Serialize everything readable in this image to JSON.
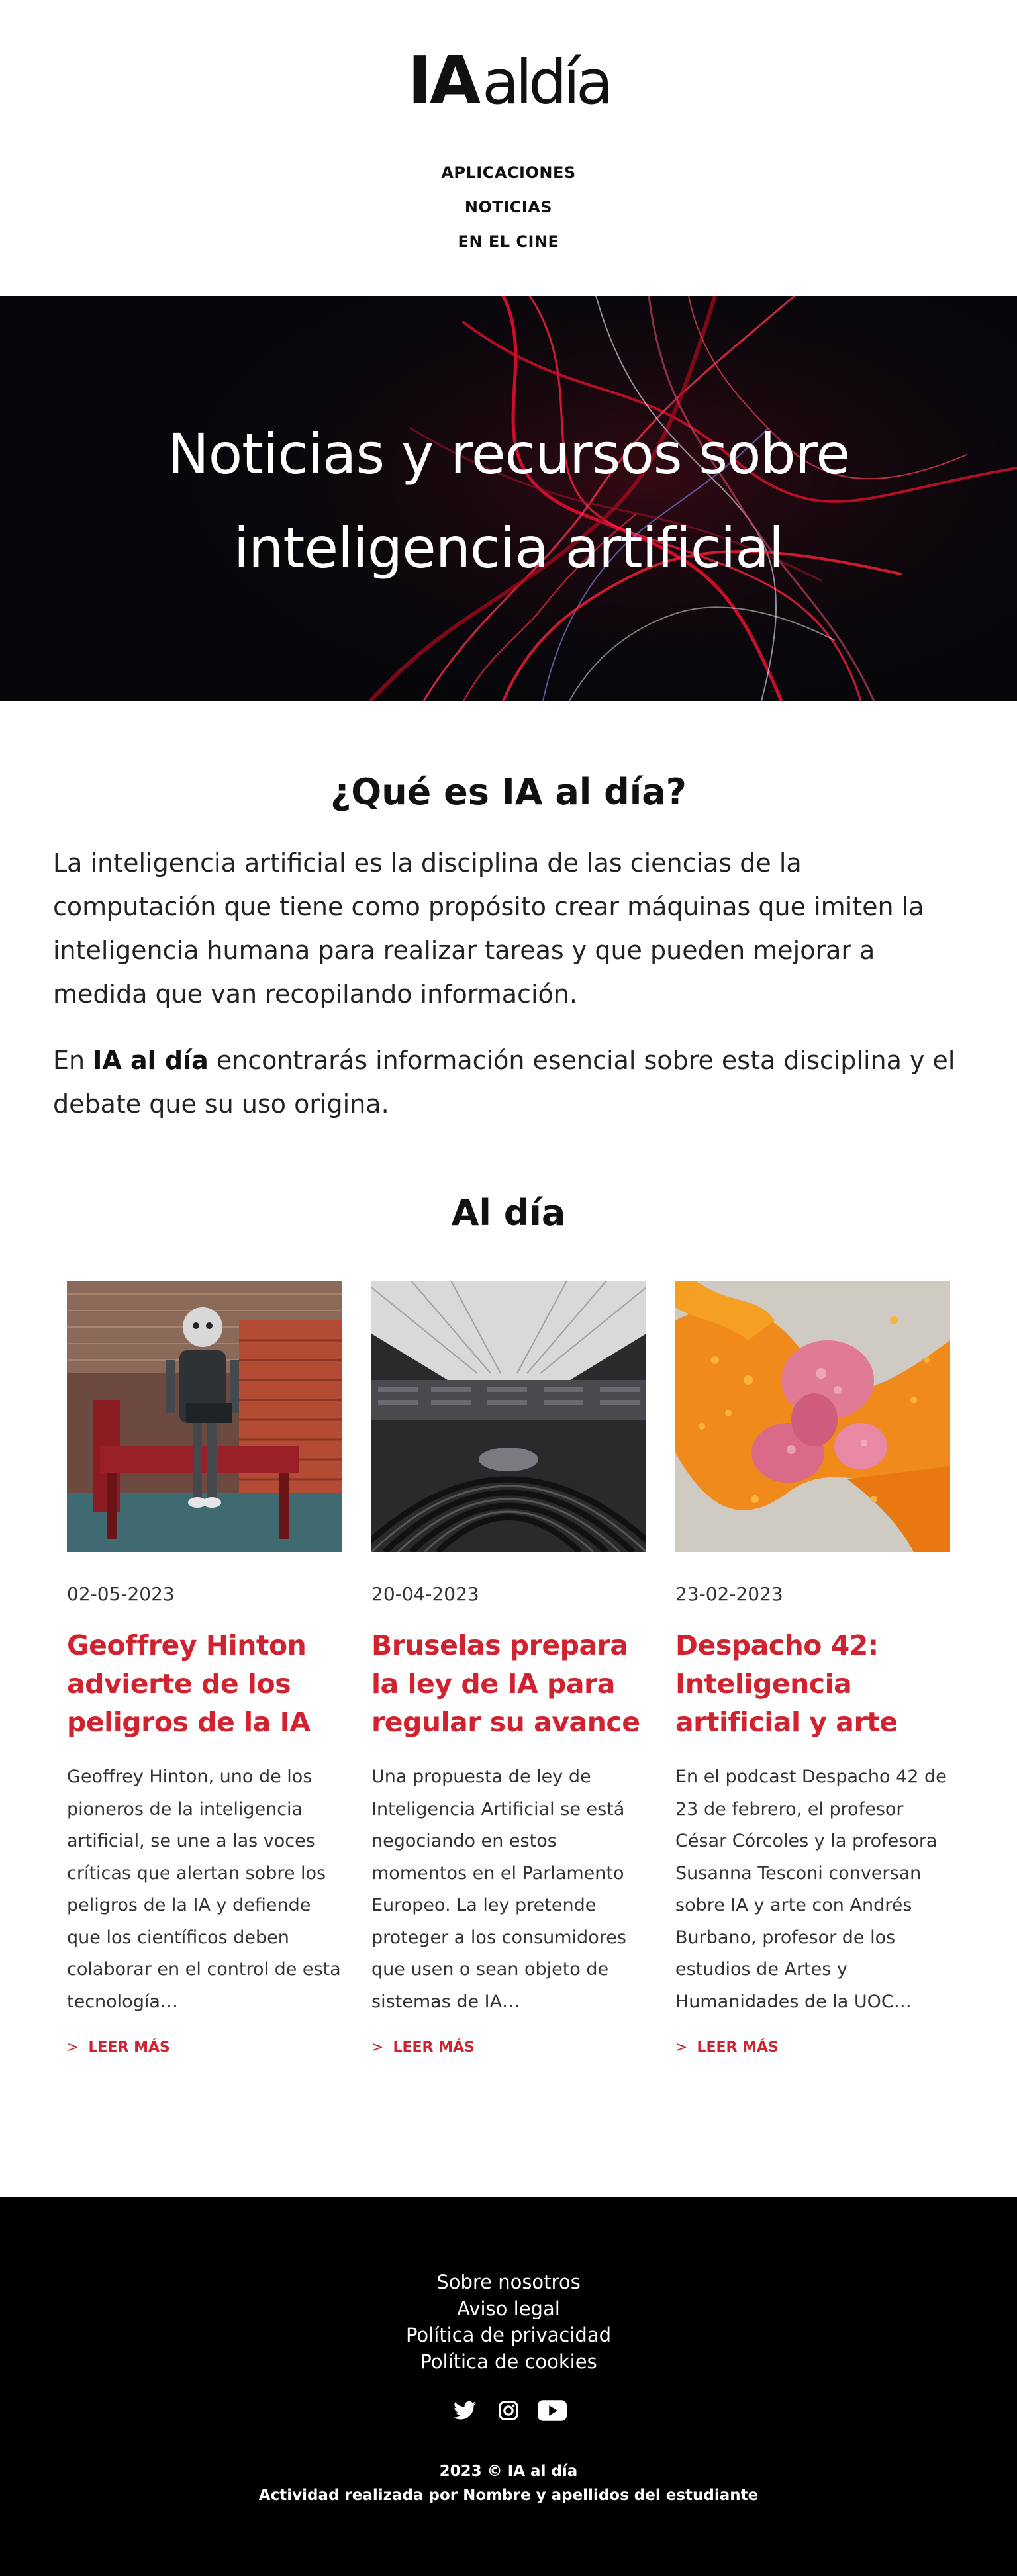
{
  "brand": {
    "logo_ia": "IA",
    "logo_aldia": "aldía"
  },
  "nav": {
    "items": [
      "APLICACIONES",
      "NOTICIAS",
      "EN EL CINE"
    ]
  },
  "hero": {
    "title_line1": "Noticias y recursos sobre",
    "title_line2": "inteligencia artificial"
  },
  "intro": {
    "heading": "¿Qué es IA al día?",
    "p1": "La inteligencia artificial es la disciplina de las ciencias de la computación que tiene como propósito crear máquinas que imiten la inteligencia humana para realizar tareas y que pueden mejorar a medida que van recopilando información.",
    "p2_before": "En ",
    "p2_bold": "IA al día",
    "p2_after": " encontrarás información esencial sobre esta disciplina y el debate que su uso origina."
  },
  "news": {
    "heading": "Al día",
    "read_more": "LEER MÁS",
    "read_more_chevron": ">",
    "cards": [
      {
        "date": "02-05-2023",
        "title": "Geoffrey Hinton advierte de los peligros de la IA",
        "text": "Geoffrey Hinton, uno de los pioneros de la inteligencia artificial, se une a las voces críticas que alertan sobre los peligros de la IA y defiende que los científicos deben colaborar en el control de esta tecnología…",
        "image": "robot-on-bench"
      },
      {
        "date": "20-04-2023",
        "title": "Bruselas prepara la ley de IA para regular su avance",
        "text": "Una propuesta de ley de Inteligencia Artificial se está negociando en estos momentos en el Parlamento Europeo. La ley pretende proteger a los consumidores que usen o sean objeto de sistemas de IA…",
        "image": "european-parliament-hemicycle"
      },
      {
        "date": "23-02-2023",
        "title": "Despacho 42: Inteligencia artificial y arte",
        "text": "En el podcast Despacho 42 de 23 de febrero, el profesor César Córcoles y la profesora Susanna Tesconi conversan sobre IA y arte con Andrés Burbano, profesor de los estudios de Artes y Humanidades de la UOC…",
        "image": "abstract-orange-pink-art"
      }
    ]
  },
  "footer": {
    "links": [
      "Sobre nosotros",
      "Aviso legal",
      "Política de privacidad",
      "Política de cookies"
    ],
    "social": [
      "twitter-icon",
      "instagram-icon",
      "youtube-icon"
    ],
    "copyright": "2023 © IA al día",
    "credit": "Actividad realizada por Nombre y apellidos del estudiante"
  },
  "colors": {
    "accent": "#d12230",
    "footer_bg": "#000000",
    "hero_bg": "#07070b"
  }
}
